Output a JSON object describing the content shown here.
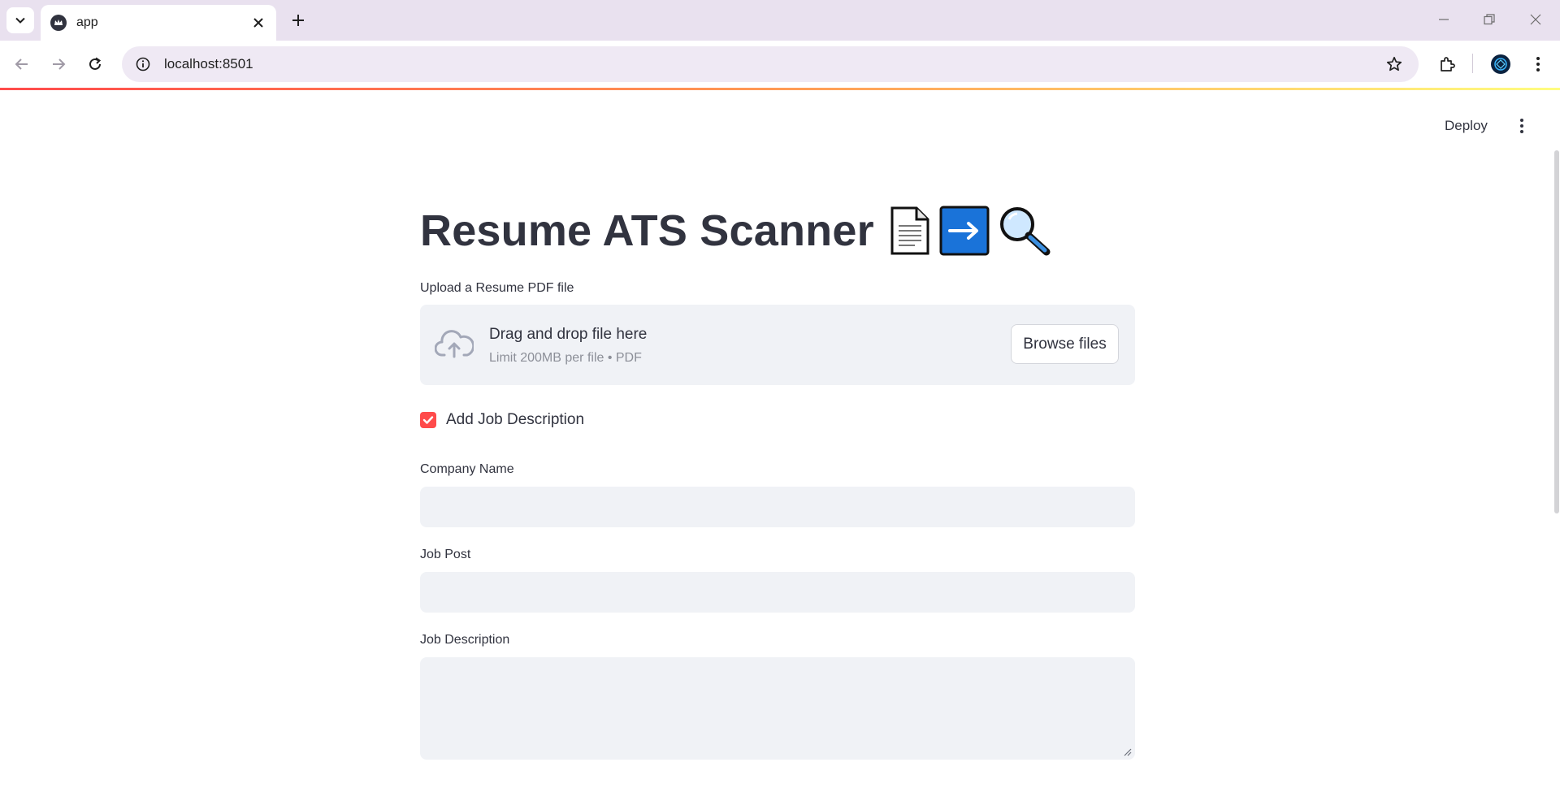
{
  "browser": {
    "tab_title": "app",
    "url": "localhost:8501"
  },
  "app": {
    "deploy_label": "Deploy",
    "title": "Resume ATS Scanner",
    "title_emojis": [
      "📄",
      "➡️",
      "🔍"
    ],
    "uploader": {
      "label": "Upload a Resume PDF file",
      "drop_text": "Drag and drop file here",
      "limit_text": "Limit 200MB per file • PDF",
      "browse_label": "Browse files"
    },
    "checkbox": {
      "label": "Add Job Description",
      "checked": true
    },
    "fields": {
      "company_label": "Company Name",
      "company_value": "",
      "job_post_label": "Job Post",
      "job_post_value": "",
      "job_desc_label": "Job Description",
      "job_desc_value": ""
    },
    "colors": {
      "accent": "#ff4b4b",
      "input_bg": "#f0f2f6",
      "text": "#31333f"
    }
  }
}
